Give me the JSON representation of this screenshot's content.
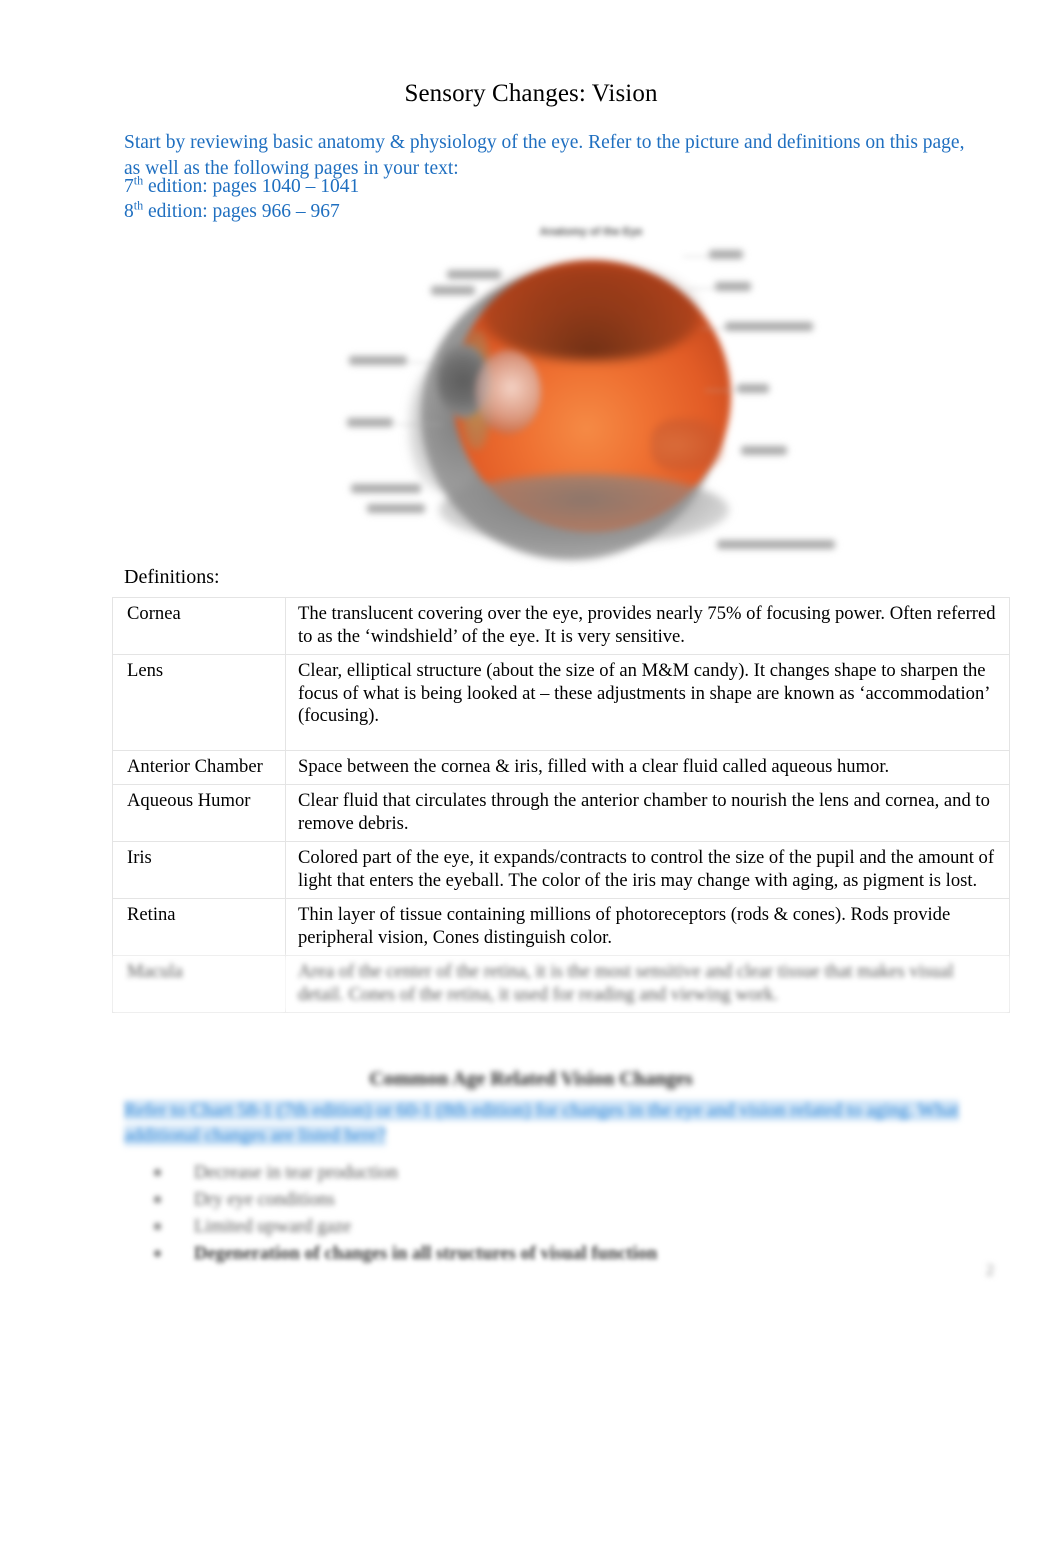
{
  "document": {
    "title": "Sensory Changes: Vision",
    "page_number": "2"
  },
  "intro": {
    "paragraph": "Start by reviewing basic anatomy & physiology of the eye. Refer to the picture and definitions on this page, as well as the following pages in your text:",
    "edition_7_prefix": "7",
    "edition_7_sup": "th",
    "edition_7_text": " edition: pages 1040 – 1041",
    "edition_8_prefix": "8",
    "edition_8_sup": "th",
    "edition_8_text": " edition: pages 966 – 967"
  },
  "figure": {
    "caption": "Anatomy of the Eye",
    "alt": "Cross-sectional diagram of the human eye with orange vitreous body, grey sclera and labelled structures"
  },
  "definitions": {
    "heading": "Definitions:",
    "rows": [
      {
        "term": "Cornea",
        "definition": "The translucent covering over the eye, provides nearly 75% of focusing power. Often referred to as the ‘windshield’ of the eye. It is very sensitive.",
        "blurred": false
      },
      {
        "term": "Lens",
        "definition": "Clear, elliptical structure (about the size of an M&M candy). It changes shape to sharpen the focus of what is being looked at – these adjustments in shape are known as ‘accommodation’ (focusing).",
        "blurred": false
      },
      {
        "term": "Anterior Chamber",
        "definition": "Space between the cornea & iris, filled with a clear fluid called aqueous humor.",
        "blurred": false
      },
      {
        "term": "Aqueous Humor",
        "definition": "Clear fluid that circulates through the anterior chamber to nourish the lens and cornea, and to remove debris.",
        "blurred": false
      },
      {
        "term": "Iris",
        "definition": "Colored part of the eye, it expands/contracts to control the size of the pupil and the amount of light that enters the eyeball. The color of the iris may change with aging, as pigment is lost.",
        "blurred": false
      },
      {
        "term": "Retina",
        "definition": "Thin layer of tissue containing millions of photoreceptors (rods & cones). Rods provide peripheral vision, Cones distinguish color.",
        "blurred": false
      },
      {
        "term": "Macula",
        "definition": "Area of the center of the retina, it is the most sensitive and clear tissue that makes visual detail. Cones of the retina, it used for reading and viewing work.",
        "blurred": true
      }
    ]
  },
  "section2": {
    "heading": "Common Age Related Vision Changes",
    "instructions": "Refer to Chart 58-1 (7th edition) or 60-1 (8th edition) for changes in the eye and vision related to aging. What additional changes are listed here?",
    "items": [
      {
        "label": "Decrease in tear production",
        "bold": false
      },
      {
        "label": "Dry eye conditions",
        "bold": false
      },
      {
        "label": "Limited upward gaze",
        "bold": false
      },
      {
        "label": "Degeneration of changes in all structures of visual function",
        "bold": true
      }
    ]
  },
  "colors": {
    "accent_blue": "#1f6fc0",
    "highlight_blue": "#2e86d6",
    "highlight_bg": "#cfe4f7",
    "text_black": "#000000",
    "table_border": "#e4e4e4",
    "eye_orange": "#e25c26",
    "eye_grey": "#8e8e8e"
  }
}
